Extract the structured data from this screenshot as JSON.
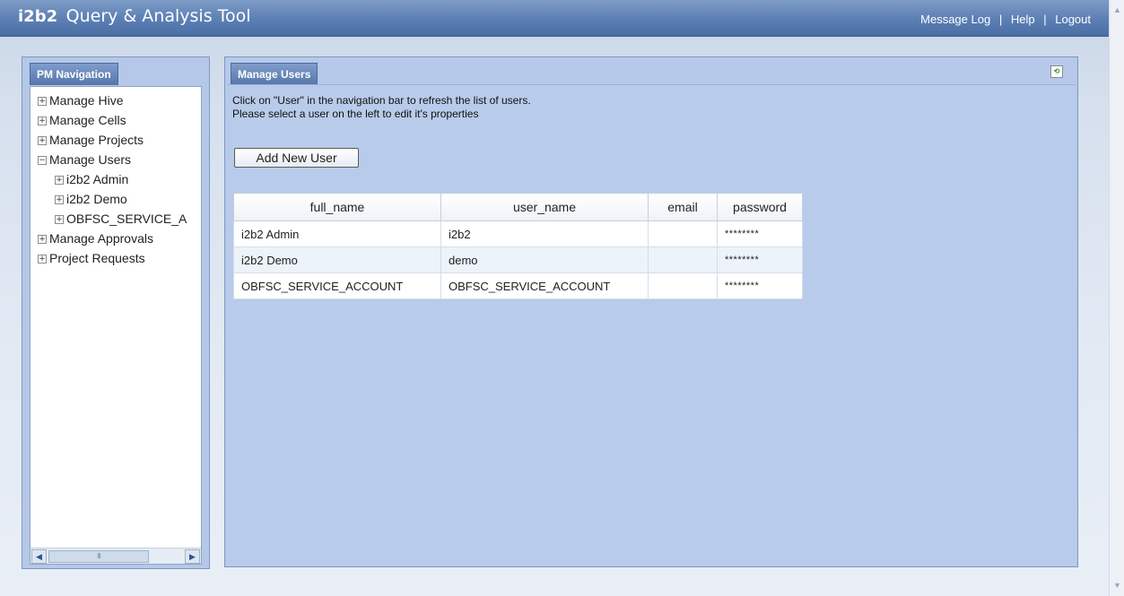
{
  "header": {
    "logo": "i2b2",
    "title": "Query & Analysis Tool",
    "links": [
      "Message Log",
      "Help",
      "Logout"
    ],
    "separator": "|"
  },
  "left_panel": {
    "tab": "PM Navigation",
    "tree": [
      {
        "label": "Manage Hive",
        "toggle": "+",
        "level": 0
      },
      {
        "label": "Manage Cells",
        "toggle": "+",
        "level": 0
      },
      {
        "label": "Manage Projects",
        "toggle": "+",
        "level": 0
      },
      {
        "label": "Manage Users",
        "toggle": "−",
        "level": 0
      },
      {
        "label": "i2b2 Admin",
        "toggle": "+",
        "level": 1
      },
      {
        "label": "i2b2 Demo",
        "toggle": "+",
        "level": 1
      },
      {
        "label": "OBFSC_SERVICE_A",
        "toggle": "+",
        "level": 1
      },
      {
        "label": "Manage Approvals",
        "toggle": "+",
        "level": 0
      },
      {
        "label": "Project Requests",
        "toggle": "+",
        "level": 0
      }
    ],
    "scroll_thumb_grip": "III"
  },
  "main_panel": {
    "tab": "Manage Users",
    "info_line1": "Click on \"User\" in the navigation bar to refresh the list of users.",
    "info_line2": "Please select a user on the left to edit it's properties",
    "add_button": "Add New User",
    "table": {
      "columns": [
        "full_name",
        "user_name",
        "email",
        "password"
      ],
      "rows": [
        [
          "i2b2 Admin",
          "i2b2",
          "",
          "********"
        ],
        [
          "i2b2 Demo",
          "demo",
          "",
          "********"
        ],
        [
          "OBFSC_SERVICE_ACCOUNT",
          "OBFSC_SERVICE_ACCOUNT",
          "",
          "********"
        ]
      ]
    }
  },
  "icons": {
    "refresh": "refresh-icon",
    "scroll_left": "arrow-left-icon",
    "scroll_right": "arrow-right-icon",
    "window_scroll_up": "arrow-up-icon",
    "window_scroll_down": "arrow-down-icon"
  },
  "colors": {
    "header": "#5b7fb4",
    "panel": "#b7c9ea",
    "tab": "#5676ab"
  }
}
